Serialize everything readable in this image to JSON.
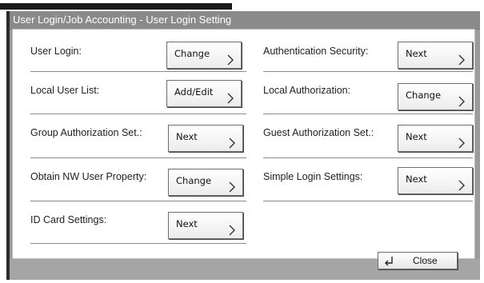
{
  "window": {
    "title": "User Login/Job Accounting - User Login Setting"
  },
  "settings": [
    {
      "label": "User Login:",
      "button": "Change"
    },
    {
      "label": "Authentication Security:",
      "button": "Next"
    },
    {
      "label": "Local User List:",
      "button": "Add/Edit"
    },
    {
      "label": "Local Authorization:",
      "button": "Change"
    },
    {
      "label": "Group Authorization Set.:",
      "button": "Next"
    },
    {
      "label": "Guest Authorization Set.:",
      "button": "Next"
    },
    {
      "label": "Obtain NW User Property:",
      "button": "Change"
    },
    {
      "label": "Simple Login Settings:",
      "button": "Next"
    },
    {
      "label": "ID Card Settings:",
      "button": "Next"
    }
  ],
  "footer": {
    "close_label": "Close",
    "close_icon": "return-arrow-icon"
  },
  "colors": {
    "titlebar": "#8a8a8a",
    "panel": "#9b9b9b",
    "content": "#ffffff",
    "button_border": "#6e6e6e"
  }
}
